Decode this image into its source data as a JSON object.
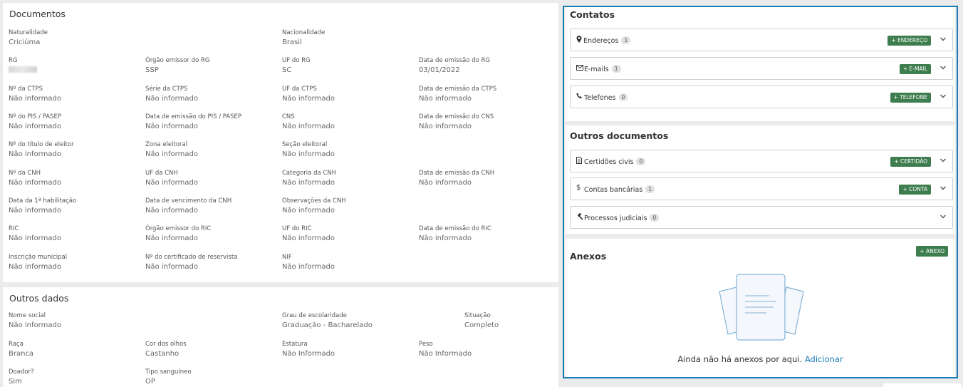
{
  "documentos": {
    "title": "Documentos",
    "fields": [
      {
        "label": "Naturalidade",
        "value": "Criciúma"
      },
      {
        "label": "Nacionalidade",
        "value": "Brasil"
      },
      {
        "label": "RG",
        "value": ""
      },
      {
        "label": "Órgão emissor do RG",
        "value": "SSP"
      },
      {
        "label": "UF do RG",
        "value": "SC"
      },
      {
        "label": "Data de emissão do RG",
        "value": "03/01/2022"
      },
      {
        "label": "Nº da CTPS",
        "value": "Não informado"
      },
      {
        "label": "Série da CTPS",
        "value": "Não informado"
      },
      {
        "label": "UF da CTPS",
        "value": "Não informado"
      },
      {
        "label": "Data de emissão da CTPS",
        "value": "Não informado"
      },
      {
        "label": "Nº do PIS / PASEP",
        "value": "Não informado"
      },
      {
        "label": "Data de emissão do PIS / PASEP",
        "value": "Não informado"
      },
      {
        "label": "CNS",
        "value": "Não informado"
      },
      {
        "label": "Data de emissão do CNS",
        "value": "Não informado"
      },
      {
        "label": "Nº do título de eleitor",
        "value": "Não informado"
      },
      {
        "label": "Zona eleitoral",
        "value": "Não informado"
      },
      {
        "label": "Seção eleitoral",
        "value": "Não informado"
      },
      {
        "label": "Nº da CNH",
        "value": "Não informado"
      },
      {
        "label": "UF da CNH",
        "value": "Não informado"
      },
      {
        "label": "Categoria da CNH",
        "value": "Não informado"
      },
      {
        "label": "Data de emissão da CNH",
        "value": "Não informado"
      },
      {
        "label": "Data da 1ª habilitação",
        "value": "Não informado"
      },
      {
        "label": "Data de vencimento da CNH",
        "value": "Não informado"
      },
      {
        "label": "Observações da CNH",
        "value": "Não informado"
      },
      {
        "label": "RIC",
        "value": "Não informado"
      },
      {
        "label": "Órgão emissor do RIC",
        "value": "Não informado"
      },
      {
        "label": "UF do RIC",
        "value": "Não informado"
      },
      {
        "label": "Data de emissão do RIC",
        "value": "Não informado"
      },
      {
        "label": "Inscrição municipal",
        "value": "Não informado"
      },
      {
        "label": "Nº do certificado de reservista",
        "value": "Não informado"
      },
      {
        "label": "NIF",
        "value": "Não informado"
      }
    ]
  },
  "outros_dados": {
    "title": "Outros dados",
    "fields": [
      {
        "label": "Nome social",
        "value": "Não informado"
      },
      {
        "label": "Grau de escolaridade",
        "value": "Graduação - Bacharelado"
      },
      {
        "label": "Situação",
        "value": "Completo"
      },
      {
        "label": "Raça",
        "value": "Branca"
      },
      {
        "label": "Cor dos olhos",
        "value": "Castanho"
      },
      {
        "label": "Estatura",
        "value": "Não Informado"
      },
      {
        "label": "Peso",
        "value": "Não Informado"
      },
      {
        "label": "Doador?",
        "value": "Sim"
      },
      {
        "label": "Tipo sanguíneo",
        "value": "OP"
      }
    ]
  },
  "contatos": {
    "title": "Contatos",
    "rows": [
      {
        "icon": "map-marker-icon",
        "label": "Endereços",
        "count": "1",
        "button": "+ ENDEREÇO"
      },
      {
        "icon": "envelope-icon",
        "label": "E-mails",
        "count": "1",
        "button": "+ E-MAIL"
      },
      {
        "icon": "phone-icon",
        "label": "Telefones",
        "count": "0",
        "button": "+ TELEFONE"
      }
    ]
  },
  "outros_documentos": {
    "title": "Outros documentos",
    "rows": [
      {
        "icon": "document-icon",
        "label": "Certidões civis",
        "count": "0",
        "button": "+ CERTIDÃO"
      },
      {
        "icon": "dollar-icon",
        "label": "Contas bancárias",
        "count": "1",
        "button": "+ CONTA"
      },
      {
        "icon": "gavel-icon",
        "label": "Processos judiciais",
        "count": "0",
        "button": ""
      }
    ]
  },
  "anexos": {
    "title": "Anexos",
    "button": "+ ANEXO",
    "empty_text": "Ainda não há anexos por aqui.",
    "empty_link": "Adicionar"
  },
  "colors": {
    "accent": "#1a7bb9",
    "button_green": "#3e7d4e"
  }
}
